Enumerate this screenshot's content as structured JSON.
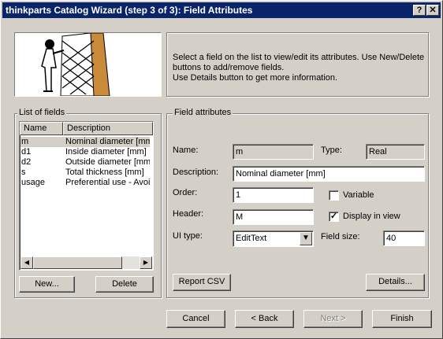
{
  "window": {
    "title": "thinkparts Catalog Wizard (step 3 of 3): Field Attributes",
    "help_label": "?",
    "close_label": "✕"
  },
  "info": {
    "line1": "Select a field on the list to view/edit its attributes. Use New/Delete",
    "line2": "buttons to add/remove fields.",
    "line3": "Use Details button to get more information."
  },
  "list": {
    "group_label": "List of fields",
    "columns": [
      "Name",
      "Description"
    ],
    "rows": [
      {
        "name": "m",
        "description": "Nominal diameter [mm]"
      },
      {
        "name": "d1",
        "description": "Inside diameter [mm]"
      },
      {
        "name": "d2",
        "description": "Outside diameter [mm]"
      },
      {
        "name": "s",
        "description": "Total thickness [mm]"
      },
      {
        "name": "usage",
        "description": "Preferential use - Avoid"
      }
    ],
    "selected_index": 0,
    "new_label": "New...",
    "delete_label": "Delete"
  },
  "attributes": {
    "group_label": "Field attributes",
    "name_label": "Name:",
    "name_value": "m",
    "type_label": "Type:",
    "type_value": "Real",
    "description_label": "Description:",
    "description_value": "Nominal diameter [mm]",
    "order_label": "Order:",
    "order_value": "1",
    "variable_label": "Variable",
    "variable_checked": false,
    "header_label": "Header:",
    "header_value": "M",
    "display_label": "Display in view",
    "display_checked": true,
    "ui_type_label": "UI type:",
    "ui_type_value": "EditText",
    "field_size_label": "Field size:",
    "field_size_value": "40",
    "report_csv_label": "Report CSV",
    "details_label": "Details..."
  },
  "footer": {
    "cancel_label": "Cancel",
    "back_label": "< Back",
    "next_label": "Next >",
    "finish_label": "Finish"
  },
  "icons": {
    "help": "help-icon",
    "close": "close-icon",
    "dropdown": "chevron-down-icon",
    "checkmark": "check-icon",
    "scroll_left": "arrow-left-icon",
    "scroll_right": "arrow-right-icon"
  }
}
